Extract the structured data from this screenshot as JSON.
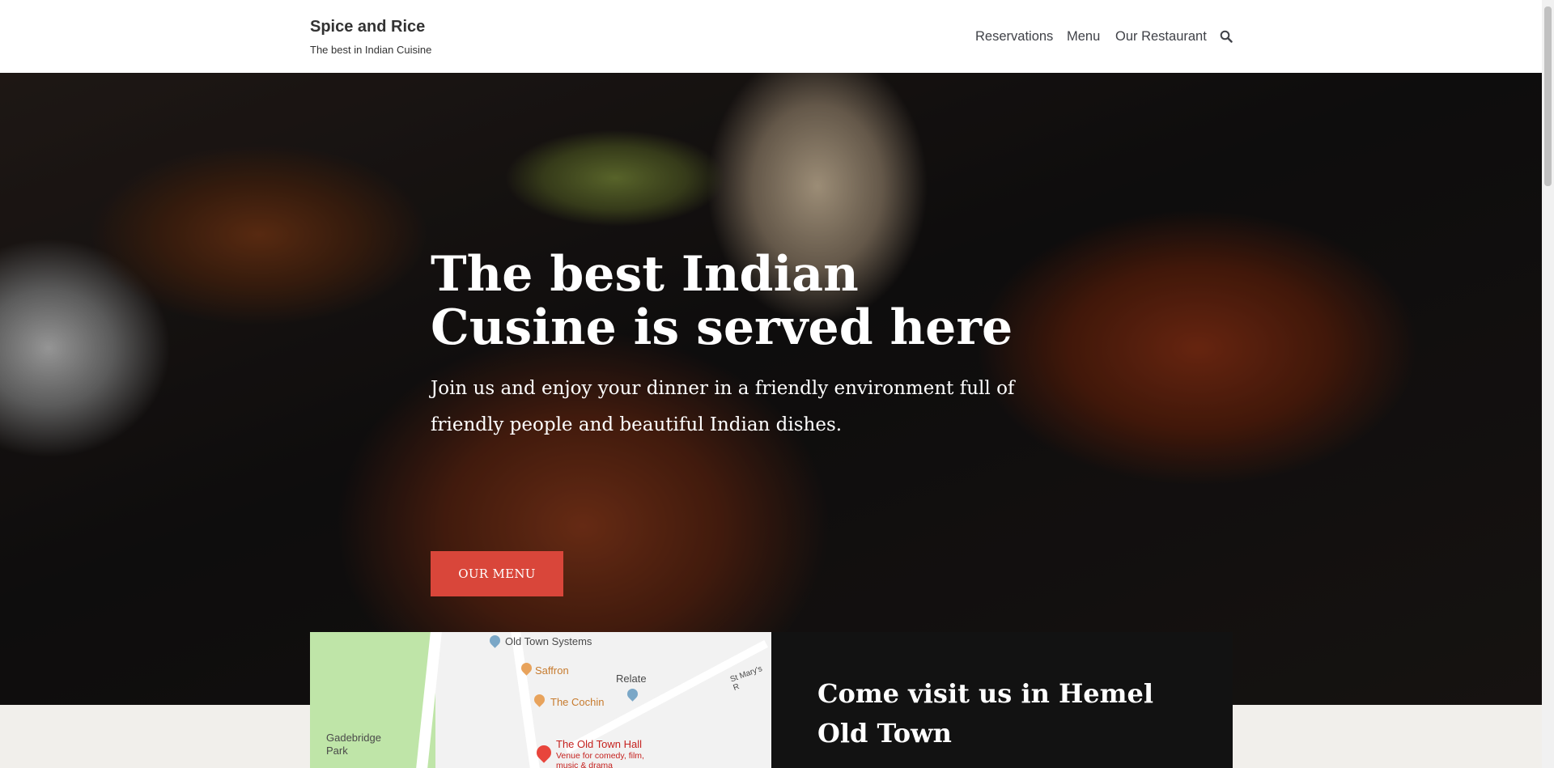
{
  "header": {
    "site_title": "Spice and Rice",
    "tagline": "The best in Indian Cuisine",
    "nav": [
      "Reservations",
      "Menu",
      "Our Restaurant"
    ]
  },
  "hero": {
    "title": "The best Indian Cusine is served here",
    "subtitle": "Join us and enjoy your dinner in a friendly environment full of friendly people and beautiful Indian dishes.",
    "button_label": "OUR MENU"
  },
  "map": {
    "labels": [
      "Old Town Systems",
      "Saffron",
      "Relate",
      "The Cochin",
      "Gadebridge Park",
      "The Old Town Hall",
      "Venue for comedy, film, music & drama",
      "St Mary's R"
    ]
  },
  "visit": {
    "title": "Come visit us in Hemel Old Town"
  },
  "colors": {
    "accent": "#d9463a",
    "dark": "#121212"
  }
}
